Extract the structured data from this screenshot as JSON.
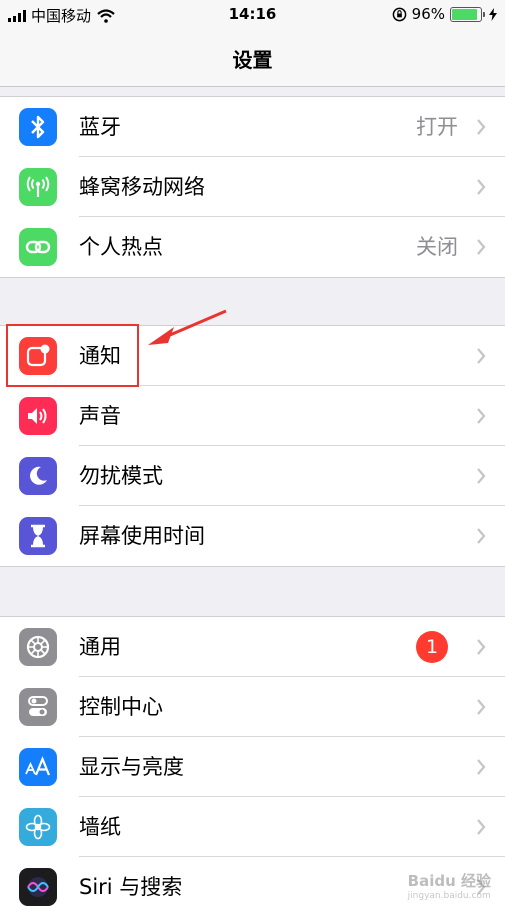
{
  "status_bar": {
    "carrier": "中国移动",
    "time": "14:16",
    "battery_percent": "96%",
    "battery_level": 0.96
  },
  "nav": {
    "title": "设置"
  },
  "groups": [
    {
      "rows": [
        {
          "label": "蓝牙",
          "value": "打开",
          "icon": "bluetooth-icon",
          "color": "#157efb"
        },
        {
          "label": "蜂窝移动网络",
          "value": "",
          "icon": "antenna-icon",
          "color": "#4cd964"
        },
        {
          "label": "个人热点",
          "value": "关闭",
          "icon": "hotspot-icon",
          "color": "#4cd964"
        }
      ]
    },
    {
      "rows": [
        {
          "label": "通知",
          "icon": "notifications-icon",
          "color": "#fc3d39"
        },
        {
          "label": "声音",
          "icon": "speaker-icon",
          "color": "#ff2d55"
        },
        {
          "label": "勿扰模式",
          "icon": "moon-icon",
          "color": "#5856d6"
        },
        {
          "label": "屏幕使用时间",
          "icon": "hourglass-icon",
          "color": "#5856d6"
        }
      ]
    },
    {
      "rows": [
        {
          "label": "通用",
          "badge": "1",
          "icon": "gear-icon",
          "color": "#8e8e93"
        },
        {
          "label": "控制中心",
          "icon": "toggles-icon",
          "color": "#8e8e93"
        },
        {
          "label": "显示与亮度",
          "icon": "text-size-icon",
          "color": "#157efb"
        },
        {
          "label": "墙纸",
          "icon": "flower-icon",
          "color": "#35aadc"
        },
        {
          "label": "Siri 与搜索",
          "icon": "siri-icon",
          "color": "#1c1c1e"
        }
      ]
    }
  ],
  "annotation": {
    "color": "#e8352f"
  },
  "watermark": {
    "text": "Baidu 经验",
    "sub": "jingyan.baidu.com"
  }
}
